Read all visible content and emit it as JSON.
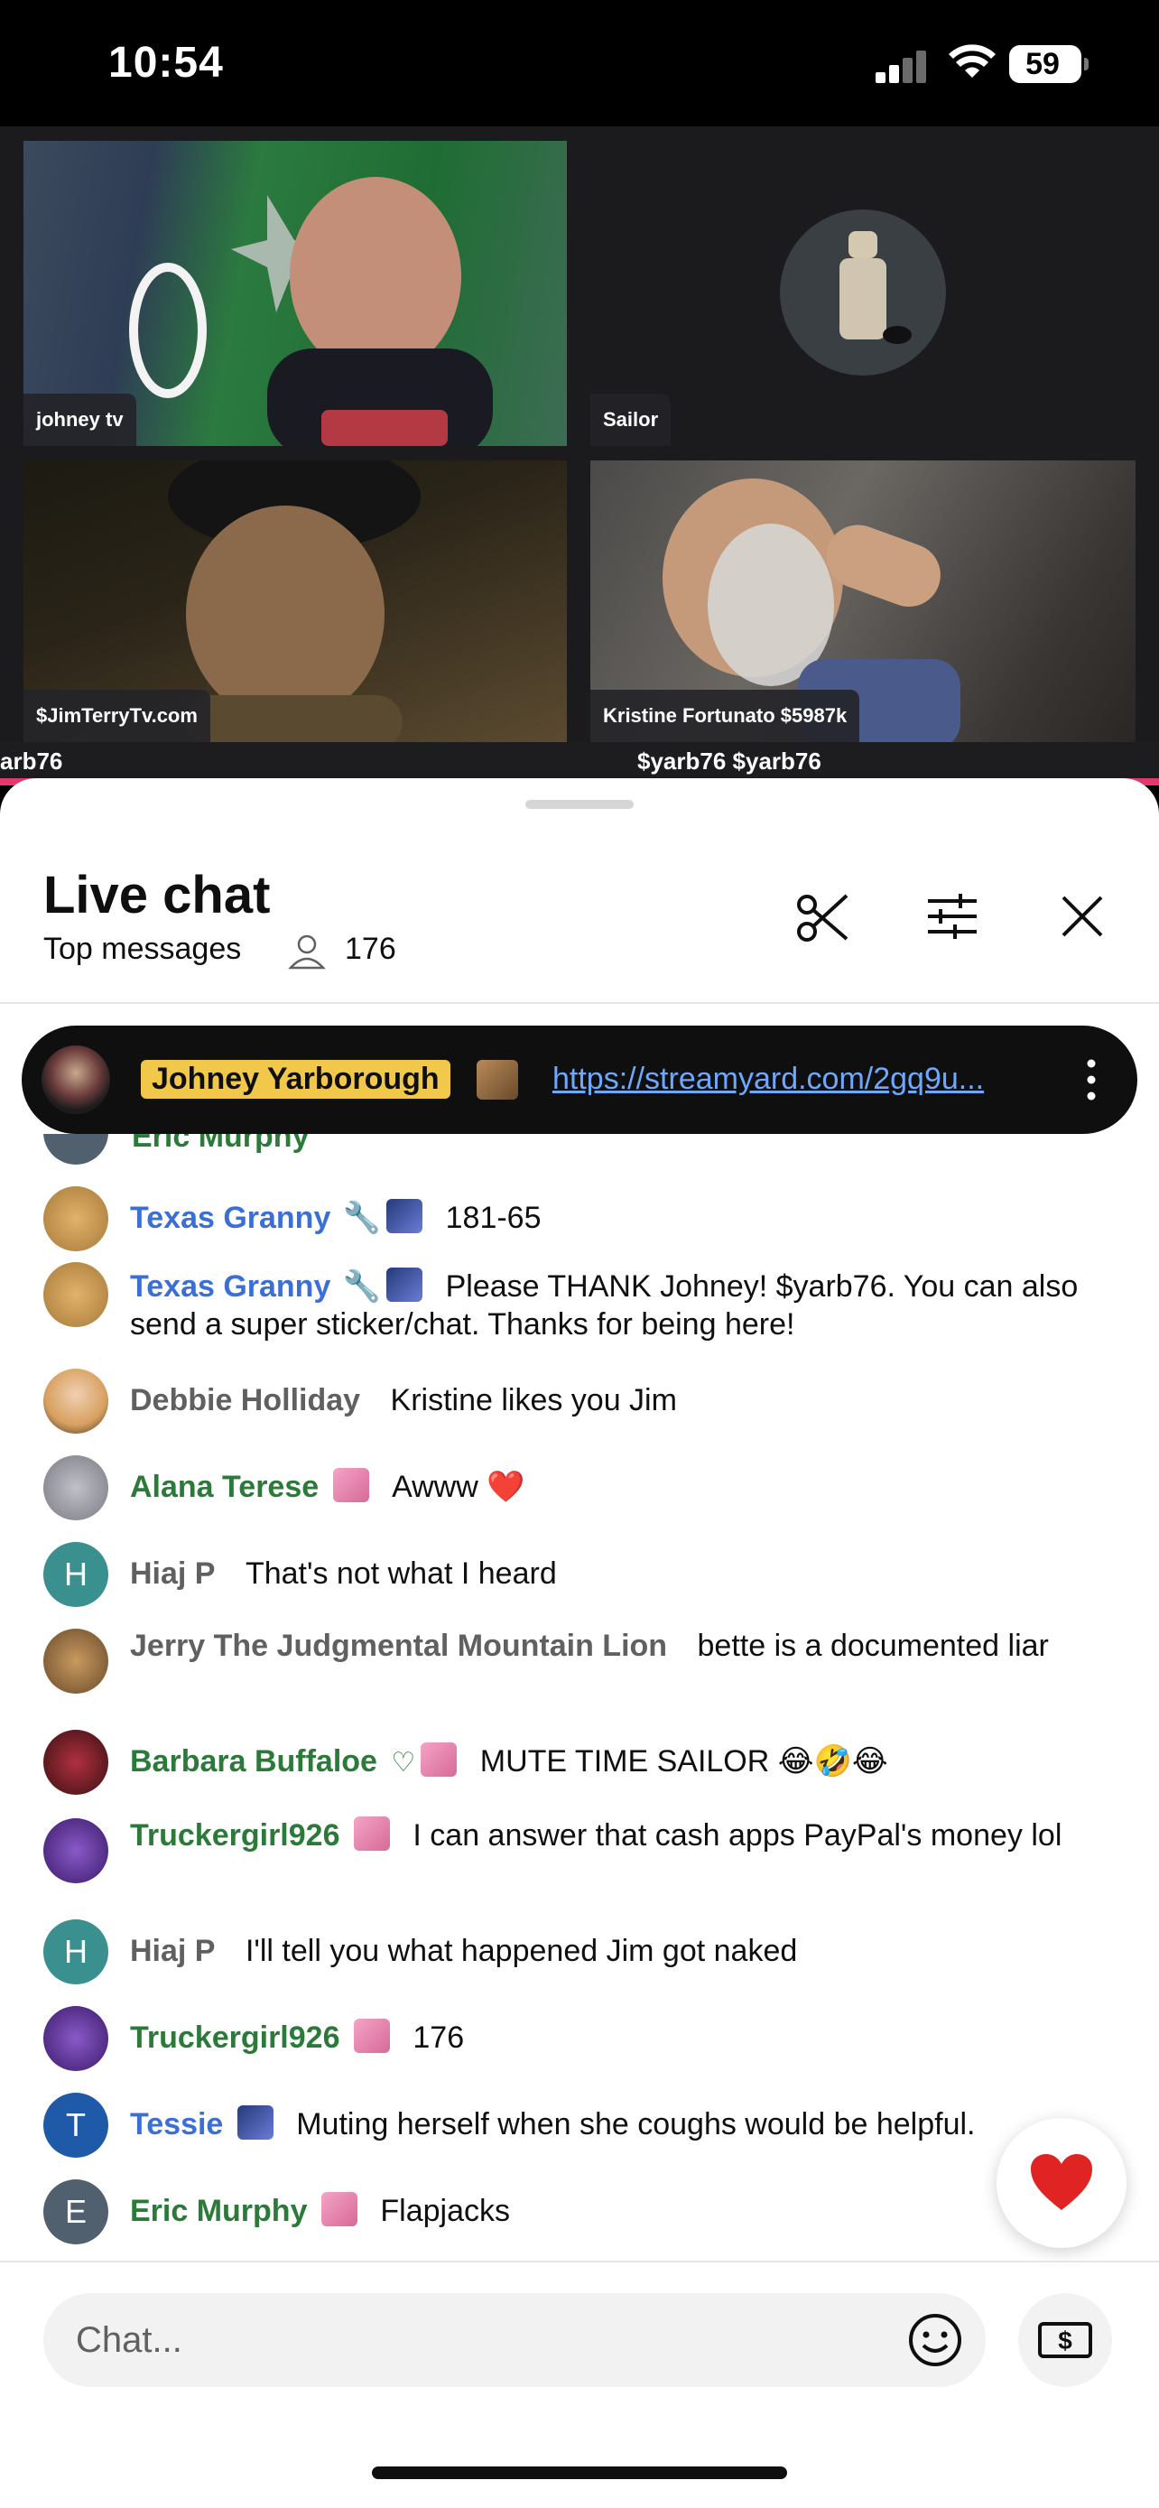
{
  "status_bar": {
    "time": "10:54",
    "battery": "59"
  },
  "stage": {
    "tiles": [
      {
        "label": "johney tv"
      },
      {
        "label": "Sailor"
      },
      {
        "label": "$JimTerryTv.com"
      },
      {
        "label": "Kristine Fortunato $5987k"
      }
    ],
    "ticker_left": "arb76",
    "ticker_right": "$yarb76 $yarb76",
    "accent_color": "#e4376b"
  },
  "chat": {
    "title": "Live chat",
    "mode": "Top messages",
    "viewer_count": "176",
    "icons": [
      "scissors-icon",
      "tune-icon",
      "close-icon"
    ],
    "pinned": {
      "author": "Johney Yarborough",
      "link": "https://streamyard.com/2gq9u..."
    },
    "partial_author": "Eric Murphy",
    "messages": [
      {
        "author": "Texas Granny",
        "text": "181-65"
      },
      {
        "author": "Texas Granny",
        "text": "Please THANK Johney! $yarb76. You can also send a super sticker/chat. Thanks for being here!"
      },
      {
        "author": "Debbie Holliday",
        "text": "Kristine likes you Jim"
      },
      {
        "author": "Alana Terese",
        "text": "Awww ❤️"
      },
      {
        "author": "Hiaj P",
        "avatar_letter": "H",
        "text": "That's not what I heard"
      },
      {
        "author": "Jerry The Judgmental Mountain Lion",
        "text": "bette is a documented liar"
      },
      {
        "author": "Barbara Buffaloe",
        "text": "MUTE TIME SAILOR 😂🤣😂"
      },
      {
        "author": "Truckergirl926",
        "text": "I can answer that cash apps PayPal's money lol"
      },
      {
        "author": "Hiaj P",
        "avatar_letter": "H",
        "text": "I'll tell you what happened Jim got naked"
      },
      {
        "author": "Truckergirl926",
        "text": "176"
      },
      {
        "author": "Tessie",
        "avatar_letter": "T",
        "text": "Muting herself when she coughs would be helpful."
      },
      {
        "author": "Eric Murphy",
        "avatar_letter": "E",
        "text": "Flapjacks"
      }
    ],
    "input_placeholder": "Chat..."
  },
  "colors": {
    "moderator_name": "#3b6fd6",
    "member_name": "#2c7a3a",
    "plain_name": "#606060",
    "pinned_highlight": "#f2c84b"
  }
}
